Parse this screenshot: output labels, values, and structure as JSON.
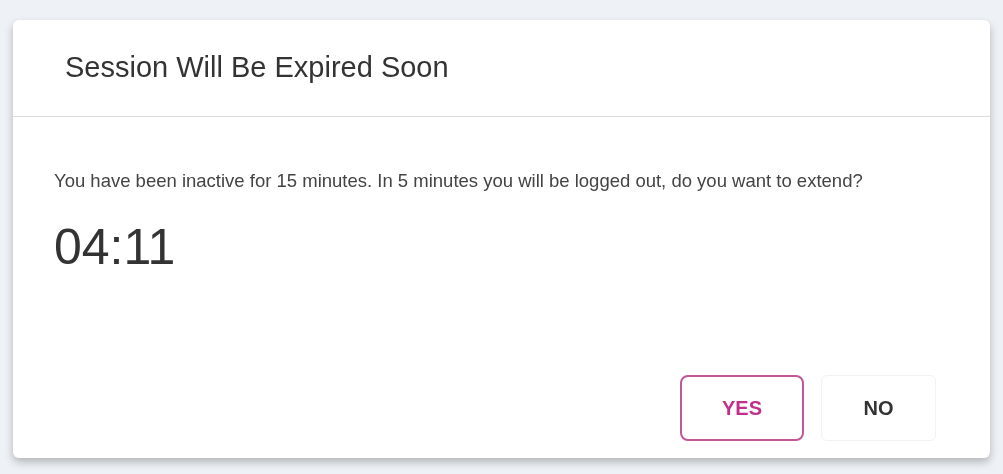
{
  "dialog": {
    "title": "Session Will Be Expired Soon",
    "message": "You have been inactive for 15 minutes. In 5 minutes you will be logged out, do you want to extend?",
    "countdown": "04:11",
    "buttons": [
      {
        "label": "YES",
        "kind": "primary"
      },
      {
        "label": "NO",
        "kind": "secondary"
      }
    ]
  }
}
